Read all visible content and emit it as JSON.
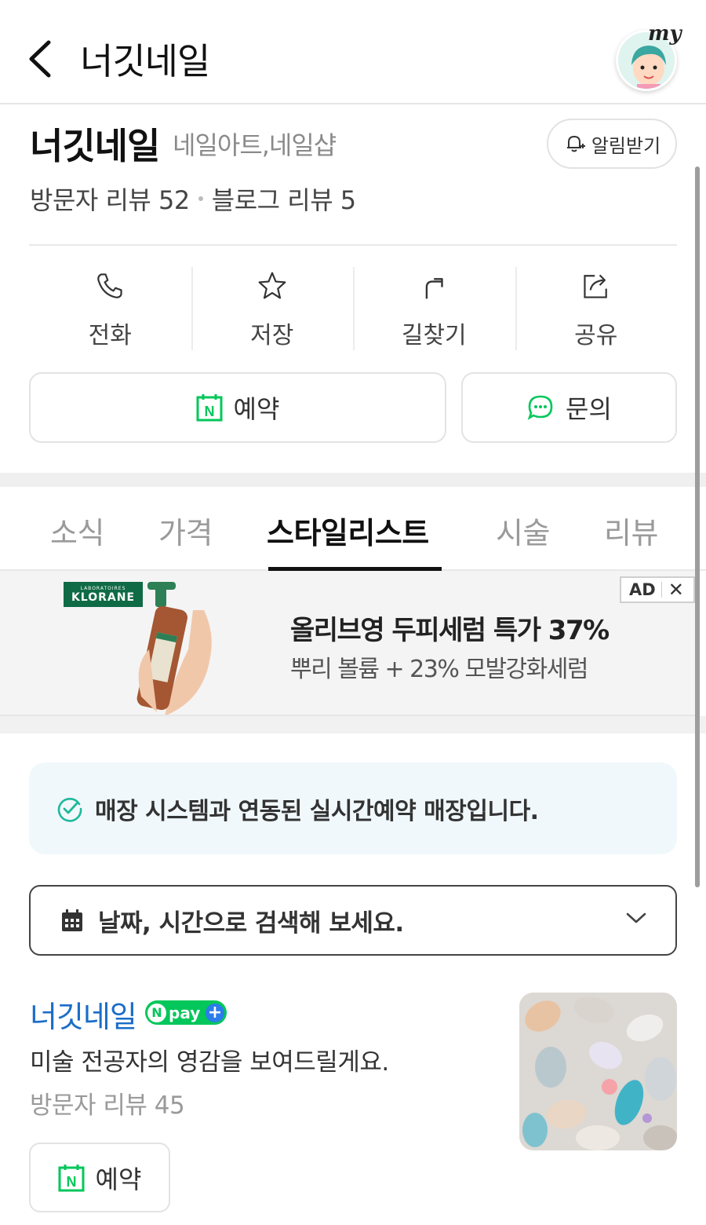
{
  "header": {
    "title": "너깃네일",
    "my_label": "my"
  },
  "place": {
    "name": "너깃네일",
    "category": "네일아트,네일샵",
    "alarm_label": "알림받기",
    "visitor_reviews": "방문자 리뷰 52",
    "blog_reviews": "블로그 리뷰 5"
  },
  "actions": [
    {
      "label": "전화",
      "icon": "phone-icon"
    },
    {
      "label": "저장",
      "icon": "star-icon"
    },
    {
      "label": "길찾기",
      "icon": "directions-icon"
    },
    {
      "label": "공유",
      "icon": "share-icon"
    }
  ],
  "buttons": {
    "book_label": "예약",
    "ask_label": "문의"
  },
  "tabs": [
    {
      "label": "소식",
      "active": false
    },
    {
      "label": "가격",
      "active": false
    },
    {
      "label": "스타일리스트",
      "active": true
    },
    {
      "label": "시술",
      "active": false
    },
    {
      "label": "리뷰",
      "active": false
    }
  ],
  "ad": {
    "brand": "KLORANE",
    "brand_small": "LABORATOIRES",
    "headline": "올리브영 두피세럼 특가 37%",
    "sub": "뿌리 볼륨 + 23% 모발강화세럼",
    "badge": "AD",
    "close": "✕"
  },
  "notice": {
    "text": "매장 시스템과 연동된 실시간예약 매장입니다."
  },
  "search": {
    "placeholder": "날짜, 시간으로 검색해 보세요."
  },
  "list_item": {
    "name": "너깃네일",
    "npay_label": "pay",
    "description": "미술 전공자의 영감을 보여드릴게요.",
    "reviews": "방문자 리뷰 45",
    "book_label": "예약"
  },
  "colors": {
    "naver_green": "#03c75a",
    "link_blue": "#1a6dc9",
    "notice_bg": "#f1f8fc"
  }
}
